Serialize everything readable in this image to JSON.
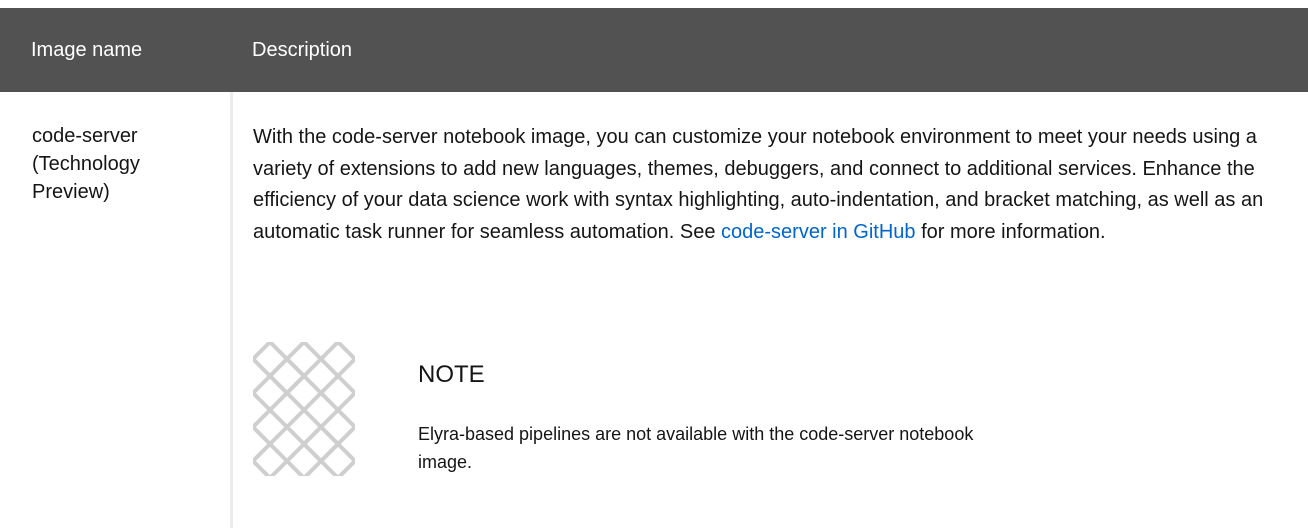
{
  "table": {
    "headers": {
      "image_name": "Image name",
      "description": "Description"
    },
    "rows": [
      {
        "image_name": "code-server (Technology Preview)",
        "description_before_link": "With the code-server notebook image, you can customize your notebook environment to meet your needs using a variety of extensions to add new languages, themes, debuggers, and connect to additional services. Enhance the efficiency of your data science work with syntax highlighting, auto-indentation, and bracket matching, as well as an automatic task runner for seamless automation. See ",
        "link_text": "code-server in GitHub",
        "description_after_link": " for more information.",
        "note": {
          "icon": "note-pattern-icon",
          "title": "NOTE",
          "body": "Elyra-based pipelines are not available with the code-server notebook image."
        }
      }
    ]
  },
  "colors": {
    "header_bg": "#525252",
    "header_text": "#ffffff",
    "link": "#0066cc",
    "divider": "#ececec"
  }
}
